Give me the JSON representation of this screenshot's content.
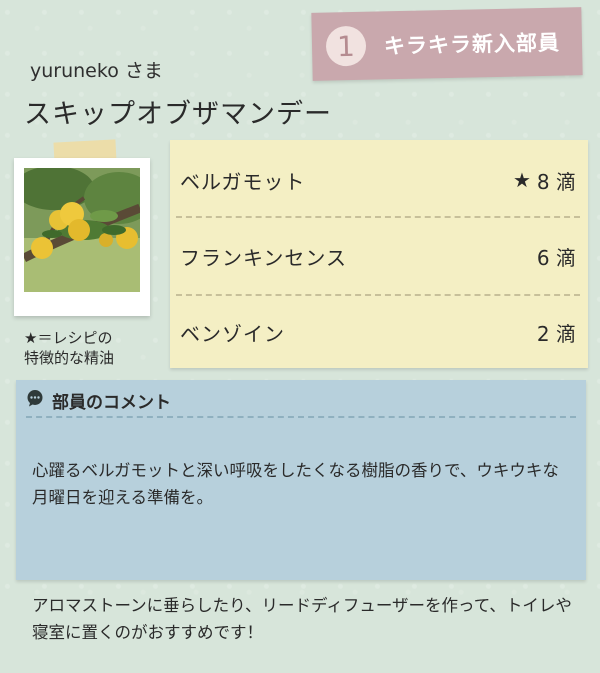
{
  "badge": {
    "number": "1",
    "label": "キラキラ新入部員"
  },
  "user": {
    "name": "yuruneko さま"
  },
  "blend": {
    "title": "スキップオブザマンデー"
  },
  "photo": {
    "alt_subject": "bergamot-fruit"
  },
  "legend": {
    "line1": "★＝レシピの",
    "line2": "特徴的な精油"
  },
  "recipe": {
    "items": [
      {
        "name": "ベルガモット",
        "mark": "★",
        "amount": "8 滴"
      },
      {
        "name": "フランキンセンス",
        "mark": "",
        "amount": "6 滴"
      },
      {
        "name": "ベンゾイン",
        "mark": "",
        "amount": "2 滴"
      }
    ]
  },
  "comment": {
    "icon": "chat-bubble-icon",
    "heading": "部員のコメント",
    "paragraph1": "心躍るベルガモットと深い呼吸をしたくなる樹脂の香りで、ウキウキな月曜日を迎える準備を。",
    "paragraph2": "アロマストーンに垂らしたり、リードディフューザーを作って、トイレや寝室に置くのがおすすめです！"
  },
  "colors": {
    "background": "#d7e5da",
    "badge": "#c9a8ad",
    "recipe_card": "#f4efc4",
    "comment_card": "#b7d0dc"
  }
}
